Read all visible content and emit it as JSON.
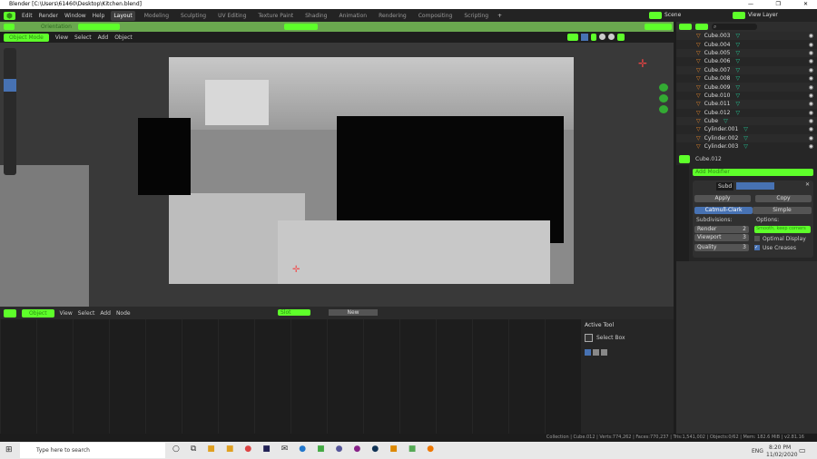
{
  "window": {
    "title": "Blender [C:\\Users\\61460\\Desktop\\Kitchen.blend]",
    "min": "—",
    "max": "❐",
    "close": "✕"
  },
  "menu": {
    "items": [
      "Edit",
      "Render",
      "Window",
      "Help"
    ],
    "workspaces": [
      "Layout",
      "Modeling",
      "Sculpting",
      "UV Editing",
      "Texture Paint",
      "Shading",
      "Animation",
      "Rendering",
      "Compositing",
      "Scripting"
    ],
    "add": "+",
    "scene": "Scene",
    "view_layer": "View Layer"
  },
  "toolbar": {
    "orientation": "Orientation"
  },
  "viewport_header": {
    "mode": "Object Mode",
    "menus": [
      "View",
      "Select",
      "Add",
      "Object"
    ]
  },
  "outliner": {
    "items": [
      "Cube.003",
      "Cube.004",
      "Cube.005",
      "Cube.006",
      "Cube.007",
      "Cube.008",
      "Cube.009",
      "Cube.010",
      "Cube.011",
      "Cube.012",
      "Cube",
      "Cylinder.001",
      "Cylinder.002",
      "Cylinder.003"
    ]
  },
  "properties": {
    "object": "Cube.012",
    "add_modifier": "Add Modifier",
    "modifier_name": "Subd",
    "apply": "Apply",
    "copy": "Copy",
    "catmull": "Catmull-Clark",
    "simple": "Simple",
    "subdivisions": "Subdivisions:",
    "options": "Options:",
    "render_label": "Render",
    "render_val": "2",
    "viewport_label": "Viewport",
    "viewport_val": "3",
    "quality_label": "Quality",
    "quality_val": "3",
    "smooth": "Smooth, keep corners",
    "optimal": "Optimal Display",
    "creases": "Use Creases",
    "optimal_checked": false,
    "creases_checked": true
  },
  "node_header": {
    "type": "Object",
    "menus": [
      "View",
      "Select",
      "Add",
      "Node"
    ],
    "slot": "Slot",
    "new": "New"
  },
  "sidebar": {
    "title": "Active Tool",
    "tool": "Select Box"
  },
  "status": "Collection | Cube.012 | Verts:774,262 | Faces:770,237 | Tris:1,541,002 | Objects:0/62 | Mem: 182.6 MiB | v2.81.16",
  "taskbar": {
    "search": "Type here to search",
    "lang": "ENG",
    "time": "8:20 PM",
    "date": "11/02/2020"
  },
  "colors": {
    "accent": "#5eff2a",
    "header": "#6aa84f",
    "active_blue": "#4772b3"
  }
}
